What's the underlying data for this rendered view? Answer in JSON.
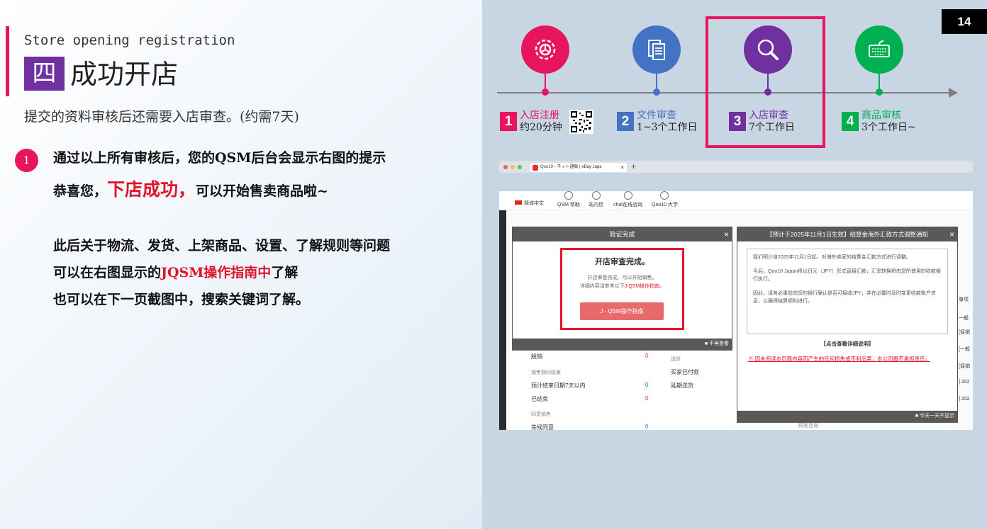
{
  "left": {
    "subtitle_en": "Store opening registration",
    "section_num": "四",
    "section_title": "成功开店",
    "intro": "提交的资料审核后还需要入店审查。(约需7天)",
    "bullet": "1",
    "p1": "通过以上所有审核后，您的QSM后台会显示右图的提示",
    "p2a": "恭喜您，",
    "p2b": "下店成功，",
    "p2c": "可以开始售卖商品啦~",
    "p3": "此后关于物流、发货、上架商品、设置、了解规则等问题",
    "p4a": "可以在右图显示的",
    "p4b": "JQSM操作指南中",
    "p4c": "了解",
    "p5": "也可以在下一页截图中，搜索关键词了解。"
  },
  "page_number": "14",
  "timeline": {
    "steps": [
      {
        "num": "1",
        "title": "入店注册",
        "sub": "约20分钟",
        "color": "#e8145e",
        "icon": "gear-icon"
      },
      {
        "num": "2",
        "title": "文件审查",
        "sub": "1~3个工作日",
        "color": "#4472c4",
        "icon": "document-icon"
      },
      {
        "num": "3",
        "title": "入店审查",
        "sub": "7个工作日",
        "color": "#7030a0",
        "icon": "search-icon"
      },
      {
        "num": "4",
        "title": "商品审核",
        "sub": "3个工作日~",
        "color": "#00b050",
        "icon": "keyboard-icon"
      }
    ]
  },
  "browser": {
    "tab_title": "Qoo10 - ネット通販 | eBay Japa",
    "tab_close": "×",
    "new_tab": "+"
  },
  "qsm": {
    "nav": [
      "简体中文",
      "QSM 帮助",
      "站内信",
      "chat在线咨询",
      "Qoo10 大学"
    ],
    "modal1": {
      "header": "验证完成",
      "close": "×",
      "title": "开店审查完成。",
      "line1": "开店审查完成。可以开始销售。",
      "line2a": "详细内容请参考以下",
      "line2b": "J QSM操作指南。",
      "button": "J - QSM操作指南",
      "footer": "■ 不再查看"
    },
    "modal2": {
      "header": "【预计于2025年11月1日生效】结算金海外汇款方式调整通知",
      "close": "×",
      "para1": "我们预计自2025年11月1日起，对海外卖家的结算金汇款方式进行调整。",
      "para2": "今后，Qoo10 Japan将以日元（JPY）形式直接汇款，汇率转换将由您所使用的收款银行执行。",
      "para3": "因此，请务必事前向您的银行确认是否可接收JPY，并在必要时及时变更收款账户信息，以确保结算顺利进行。",
      "link": "【点击查看详细说明】",
      "warning": "※ 因未阅读本页面内容而产生的任何损失或不利后果，本公司概不承担责任。",
      "footer": "■ 今天一天不显示"
    },
    "list": {
      "r1": "脱销",
      "r1v": "0",
      "r2": "销售期间结束",
      "r3": "预计结束日期7天以内",
      "r3v": "0",
      "r4": "已结束",
      "r4v": "0",
      "r5": "同意销售",
      "r6": "等候同意",
      "r6v": "0",
      "c1": "送货",
      "c2": "买家已付款",
      "c3": "延期送货",
      "c4": "顾客咨询"
    },
    "side": [
      "事项",
      "一般",
      "[促销",
      "[一般",
      "[促销",
      "] 202",
      "] 202"
    ]
  }
}
